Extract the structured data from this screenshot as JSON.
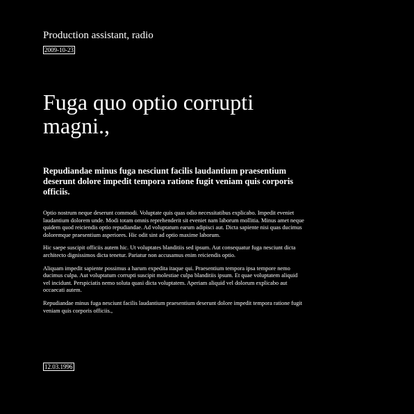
{
  "header": {
    "title": "Production assistant, radio",
    "date": "2009-10-23"
  },
  "article": {
    "headline": "Fuga quo optio corrupti magni.,",
    "lead": "Repudiandae minus fuga nesciunt facilis laudantium praesentium deserunt dolore impedit tempora ratione fugit veniam quis corporis officiis.",
    "paragraphs": [
      "Optio nostrum neque deserunt commodi. Voluptate quis quas odio necessitatibus explicabo. Impedit eveniet laudantium dolorem unde. Modi totam omnis reprehenderit sit eveniet nam laborum mollitia. Minus amet neque quidem quod reiciendis optio repudiandae. Ad voluptatum earum adipisci aut. Dicta sapiente nisi quas ducimus doloremque praesentium asperiores. Hic odit sint ad optio maxime laborum.",
      "Hic saepe suscipit officiis autem hic. Ut voluptates blanditiis sed ipsum. Aut consequatur fuga nesciunt dicta architecto dignissimos dicta tenetur. Pariatur non accusamus enim reiciendis optio.",
      "Aliquam impedit sapiente possimus a harum expedita itaque qui. Praesentium tempora ipsa tempore nemo ducimus culpa. Aut voluptatum corrupti suscipit molestiae culpa blanditiis ipsum. Et quae voluptatem aliquid vel incidunt. Perspiciatis nemo soluta quasi dicta voluptatem. Aperiam aliquid vel dolorum explicabo aut occaecati autem.",
      "Repudiandae minus fuga nesciunt facilis laudantium praesentium deserunt dolore impedit tempora ratione fugit veniam quis corporis officiis.,"
    ]
  },
  "footer": {
    "date": "12.03.1996"
  },
  "colors": {
    "background": "#000000",
    "text": "#ffffff"
  }
}
